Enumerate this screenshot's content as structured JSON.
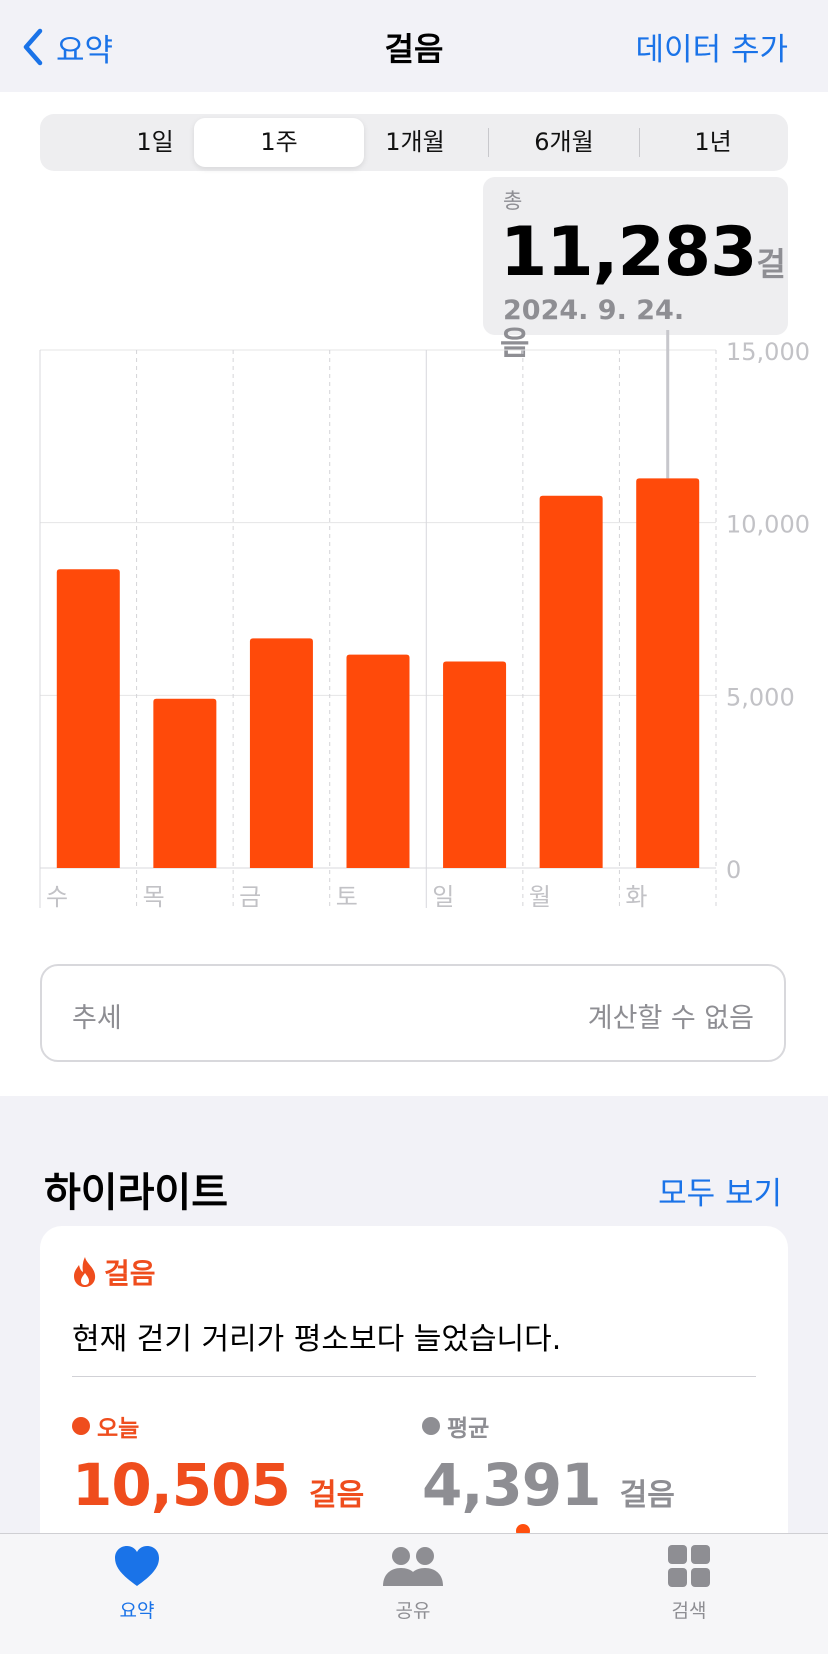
{
  "nav": {
    "back_label": "요약",
    "title": "걸음",
    "action_label": "데이터 추가"
  },
  "segments": {
    "items": [
      "1일",
      "1주",
      "1개월",
      "6개월",
      "1년"
    ],
    "selected": "1주"
  },
  "callout": {
    "label": "총",
    "value": "11,283",
    "unit": "걸음",
    "date": "2024. 9. 24."
  },
  "chart_data": {
    "type": "bar",
    "categories": [
      "수",
      "목",
      "금",
      "토",
      "일",
      "월",
      "화"
    ],
    "values": [
      8650,
      4900,
      6650,
      6180,
      5980,
      10780,
      11283
    ],
    "ylim": [
      0,
      15000
    ],
    "yticks": [
      0,
      5000,
      10000,
      15000
    ],
    "ytick_labels": [
      "0",
      "5,000",
      "10,000",
      "15,000"
    ],
    "selected_index": 6,
    "bar_color": "#ff4a0a",
    "grid": true
  },
  "trend": {
    "label": "추세",
    "value": "계산할 수 없음"
  },
  "highlights": {
    "title": "하이라이트",
    "link_label": "모두 보기",
    "card": {
      "category": "걸음",
      "category_icon": "flame-icon",
      "description": "현재 걷기 거리가 평소보다 늘었습니다.",
      "today": {
        "label": "오늘",
        "value": "10,505",
        "unit": "걸음",
        "color": "#ef4d1d"
      },
      "average": {
        "label": "평균",
        "value": "4,391",
        "unit": "걸음",
        "color": "#8e8e93"
      }
    }
  },
  "tabbar": {
    "items": [
      {
        "label": "요약",
        "icon": "heart-icon",
        "active": true
      },
      {
        "label": "공유",
        "icon": "people-icon",
        "active": false
      },
      {
        "label": "검색",
        "icon": "grid-icon",
        "active": false
      }
    ]
  },
  "colors": {
    "accent": "#1a73e8",
    "bar": "#ff4a0a",
    "highlight": "#ef4d1d"
  }
}
